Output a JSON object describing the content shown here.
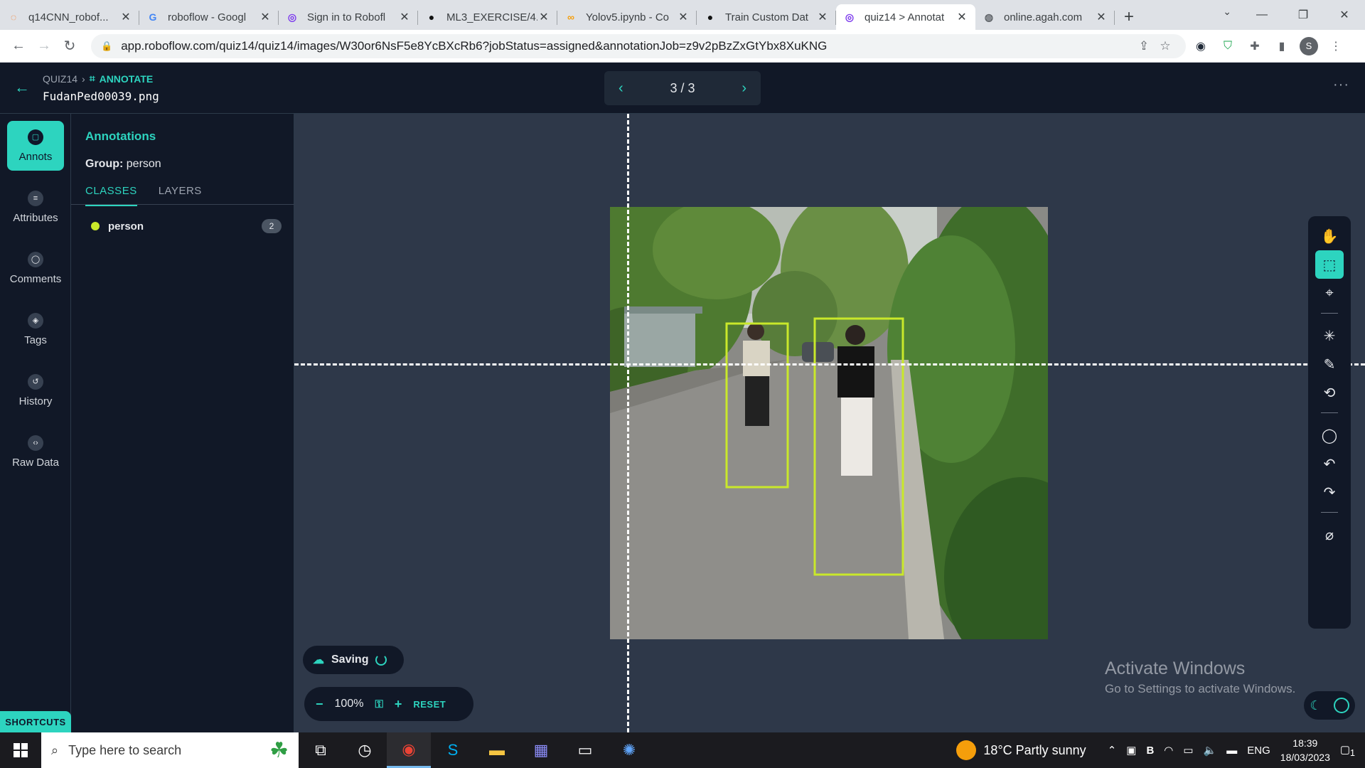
{
  "browser": {
    "tabs": [
      {
        "title": "q14CNN_robof...",
        "icon": "roboflow-orange-icon"
      },
      {
        "title": "roboflow - Googl",
        "icon": "google-icon"
      },
      {
        "title": "Sign in to Robofl",
        "icon": "roboflow-icon"
      },
      {
        "title": "ML3_EXERCISE/4.",
        "icon": "github-icon"
      },
      {
        "title": "Yolov5.ipynb - Co",
        "icon": "colab-icon"
      },
      {
        "title": "Train Custom Dat",
        "icon": "github-icon"
      },
      {
        "title": "quiz14 > Annotat",
        "icon": "roboflow-icon"
      },
      {
        "title": "online.agah.com",
        "icon": "globe-icon"
      }
    ],
    "url": "app.roboflow.com/quiz14/quiz14/images/W30or6NsF5e8YcBXcRb6?jobStatus=assigned&annotationJob=z9v2pBzZxGtYbx8XuKNG",
    "profile_initial": "S"
  },
  "header": {
    "project": "QUIZ14",
    "section": "ANNOTATE",
    "filename": "FudanPed00039.png",
    "pager": "3 / 3",
    "more": "···"
  },
  "rail": {
    "items": [
      {
        "label": "Annots",
        "icon": "annotations-icon"
      },
      {
        "label": "Attributes",
        "icon": "list-icon"
      },
      {
        "label": "Comments",
        "icon": "comment-icon"
      },
      {
        "label": "Tags",
        "icon": "tag-icon"
      },
      {
        "label": "History",
        "icon": "history-icon"
      },
      {
        "label": "Raw Data",
        "icon": "code-icon"
      }
    ],
    "shortcuts": "SHORTCUTS"
  },
  "panel": {
    "title": "Annotations",
    "group_label": "Group:",
    "group_value": "person",
    "tabs": [
      "CLASSES",
      "LAYERS"
    ],
    "classes": [
      {
        "name": "person",
        "count": "2",
        "color": "#c9e82a"
      }
    ]
  },
  "canvas": {
    "saving": "Saving",
    "zoom": "100%",
    "reset": "RESET",
    "box_color": "#c9e82a"
  },
  "watermark": {
    "line1": "Activate Windows",
    "line2": "Go to Settings to activate Windows."
  },
  "taskbar": {
    "search_placeholder": "Type here to search",
    "weather": "18°C  Partly sunny",
    "lang": "ENG",
    "time": "18:39",
    "date": "18/03/2023",
    "notifications": "1"
  }
}
